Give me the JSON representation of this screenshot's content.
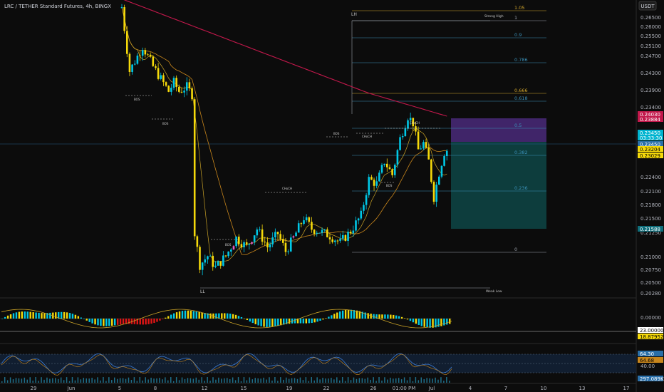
{
  "header": {
    "title": "LRC / TETHER Standard Futures, 4h, BINGX"
  },
  "currency": "USDT",
  "colors": {
    "bg": "#0c0c0c",
    "up": "#00c8e6",
    "down": "#f5d90a",
    "pink": "#e05bc6",
    "ma_red": "#c2184b",
    "ma_orange": "#c8861c",
    "ma_gold": "#c9a227",
    "fib": "#3a8fb7",
    "fib_gold": "#d4a72c",
    "purple": "#4a2a7a",
    "teal": "#0e4d4d"
  },
  "chart_data": [
    {
      "type": "candlestick",
      "title": "LRC / TETHER Standard Futures, 4h, BINGX",
      "x_ticks": [
        "29",
        "Jun",
        "5",
        "8",
        "12",
        "15",
        "19",
        "22",
        "26",
        "01:00 PM",
        "Jul",
        "4",
        "7",
        "10",
        "13",
        "17"
      ],
      "y_ticks": [
        "0.26500",
        "0.26000",
        "0.25500",
        "0.25100",
        "0.24700",
        "0.24300",
        "0.23900",
        "0.23400",
        "0.22700",
        "0.22400",
        "0.22100",
        "0.21800",
        "0.21500",
        "0.21250",
        "0.21000",
        "0.20750",
        "0.20500",
        "0.20280"
      ],
      "ylim": [
        0.2028,
        0.2665
      ],
      "price_labels": [
        {
          "text": "0.24030",
          "color": "#c2184b"
        },
        {
          "text": "0.23884",
          "color": "#c2184b"
        },
        {
          "text": "0.23450",
          "color": "#00b4d0"
        },
        {
          "text": "03:33:30",
          "color": "#00b4d0"
        },
        {
          "text": "0.23450",
          "color": "#2a6fa8"
        },
        {
          "text": "0.23204",
          "color": "#f5d90a"
        },
        {
          "text": "0.23029",
          "color": "#f5d90a"
        },
        {
          "text": "0.21588",
          "color": "#0e6d7a"
        }
      ],
      "fib_levels": [
        {
          "label": "1.05",
          "price": 0.2663
        },
        {
          "label": "1",
          "price": 0.2643
        },
        {
          "label": "0.9",
          "price": 0.2604
        },
        {
          "label": "0.786",
          "price": 0.2559
        },
        {
          "label": "0.666",
          "price": 0.2511
        },
        {
          "label": "0.618",
          "price": 0.2492
        },
        {
          "label": "0.5",
          "price": 0.2446
        },
        {
          "label": "0.382",
          "price": 0.2399
        },
        {
          "label": "0.236",
          "price": 0.2342
        },
        {
          "label": "0",
          "price": 0.2249
        }
      ],
      "annotations": [
        "LH",
        "Strong High",
        "LL",
        "Weak Low",
        "BOS",
        "BOS",
        "BOS",
        "CHoCH",
        "BOS",
        "CHoCH",
        "CHoCH",
        "BOS"
      ]
    },
    {
      "type": "histogram",
      "name": "momentum",
      "y_ticks": [
        "0.00000"
      ],
      "value_labels": [
        "23.00000",
        "18.87952"
      ]
    },
    {
      "type": "line",
      "name": "oscillator",
      "y_ticks": [
        "40.00"
      ],
      "value_labels": [
        "64.30",
        "64.68",
        "297.089K"
      ]
    }
  ]
}
